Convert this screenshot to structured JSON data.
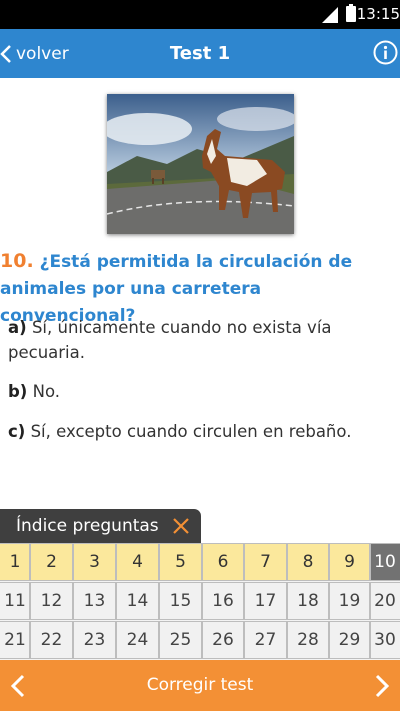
{
  "status_bar": {
    "time": "13:15"
  },
  "app_bar": {
    "back_label": "volver",
    "title": "Test 1"
  },
  "question": {
    "number": "10.",
    "text": "¿Está permitida la circulación de animales por una carretera convencional?"
  },
  "answers": [
    {
      "letter": "a)",
      "text": "Sí, únicamente cuando no exista vía pecuaria."
    },
    {
      "letter": "b)",
      "text": "No."
    },
    {
      "letter": "c)",
      "text": "Sí, excepto cuando circulen en rebaño."
    }
  ],
  "index_panel": {
    "label": "Índice preguntas",
    "rows": [
      [
        "1",
        "2",
        "3",
        "4",
        "5",
        "6",
        "7",
        "8",
        "9",
        "10"
      ],
      [
        "11",
        "12",
        "13",
        "14",
        "15",
        "16",
        "17",
        "18",
        "19",
        "20"
      ],
      [
        "21",
        "22",
        "23",
        "24",
        "25",
        "26",
        "27",
        "28",
        "29",
        "30"
      ]
    ],
    "answered_count": 9,
    "current_question": "10"
  },
  "bottom_bar": {
    "label": "Corregir test"
  },
  "colors": {
    "primary": "#2e86cf",
    "accent": "#f08030",
    "answered_cell": "#fbe89c",
    "current_cell": "#727272",
    "bottom_bar": "#f39035"
  }
}
